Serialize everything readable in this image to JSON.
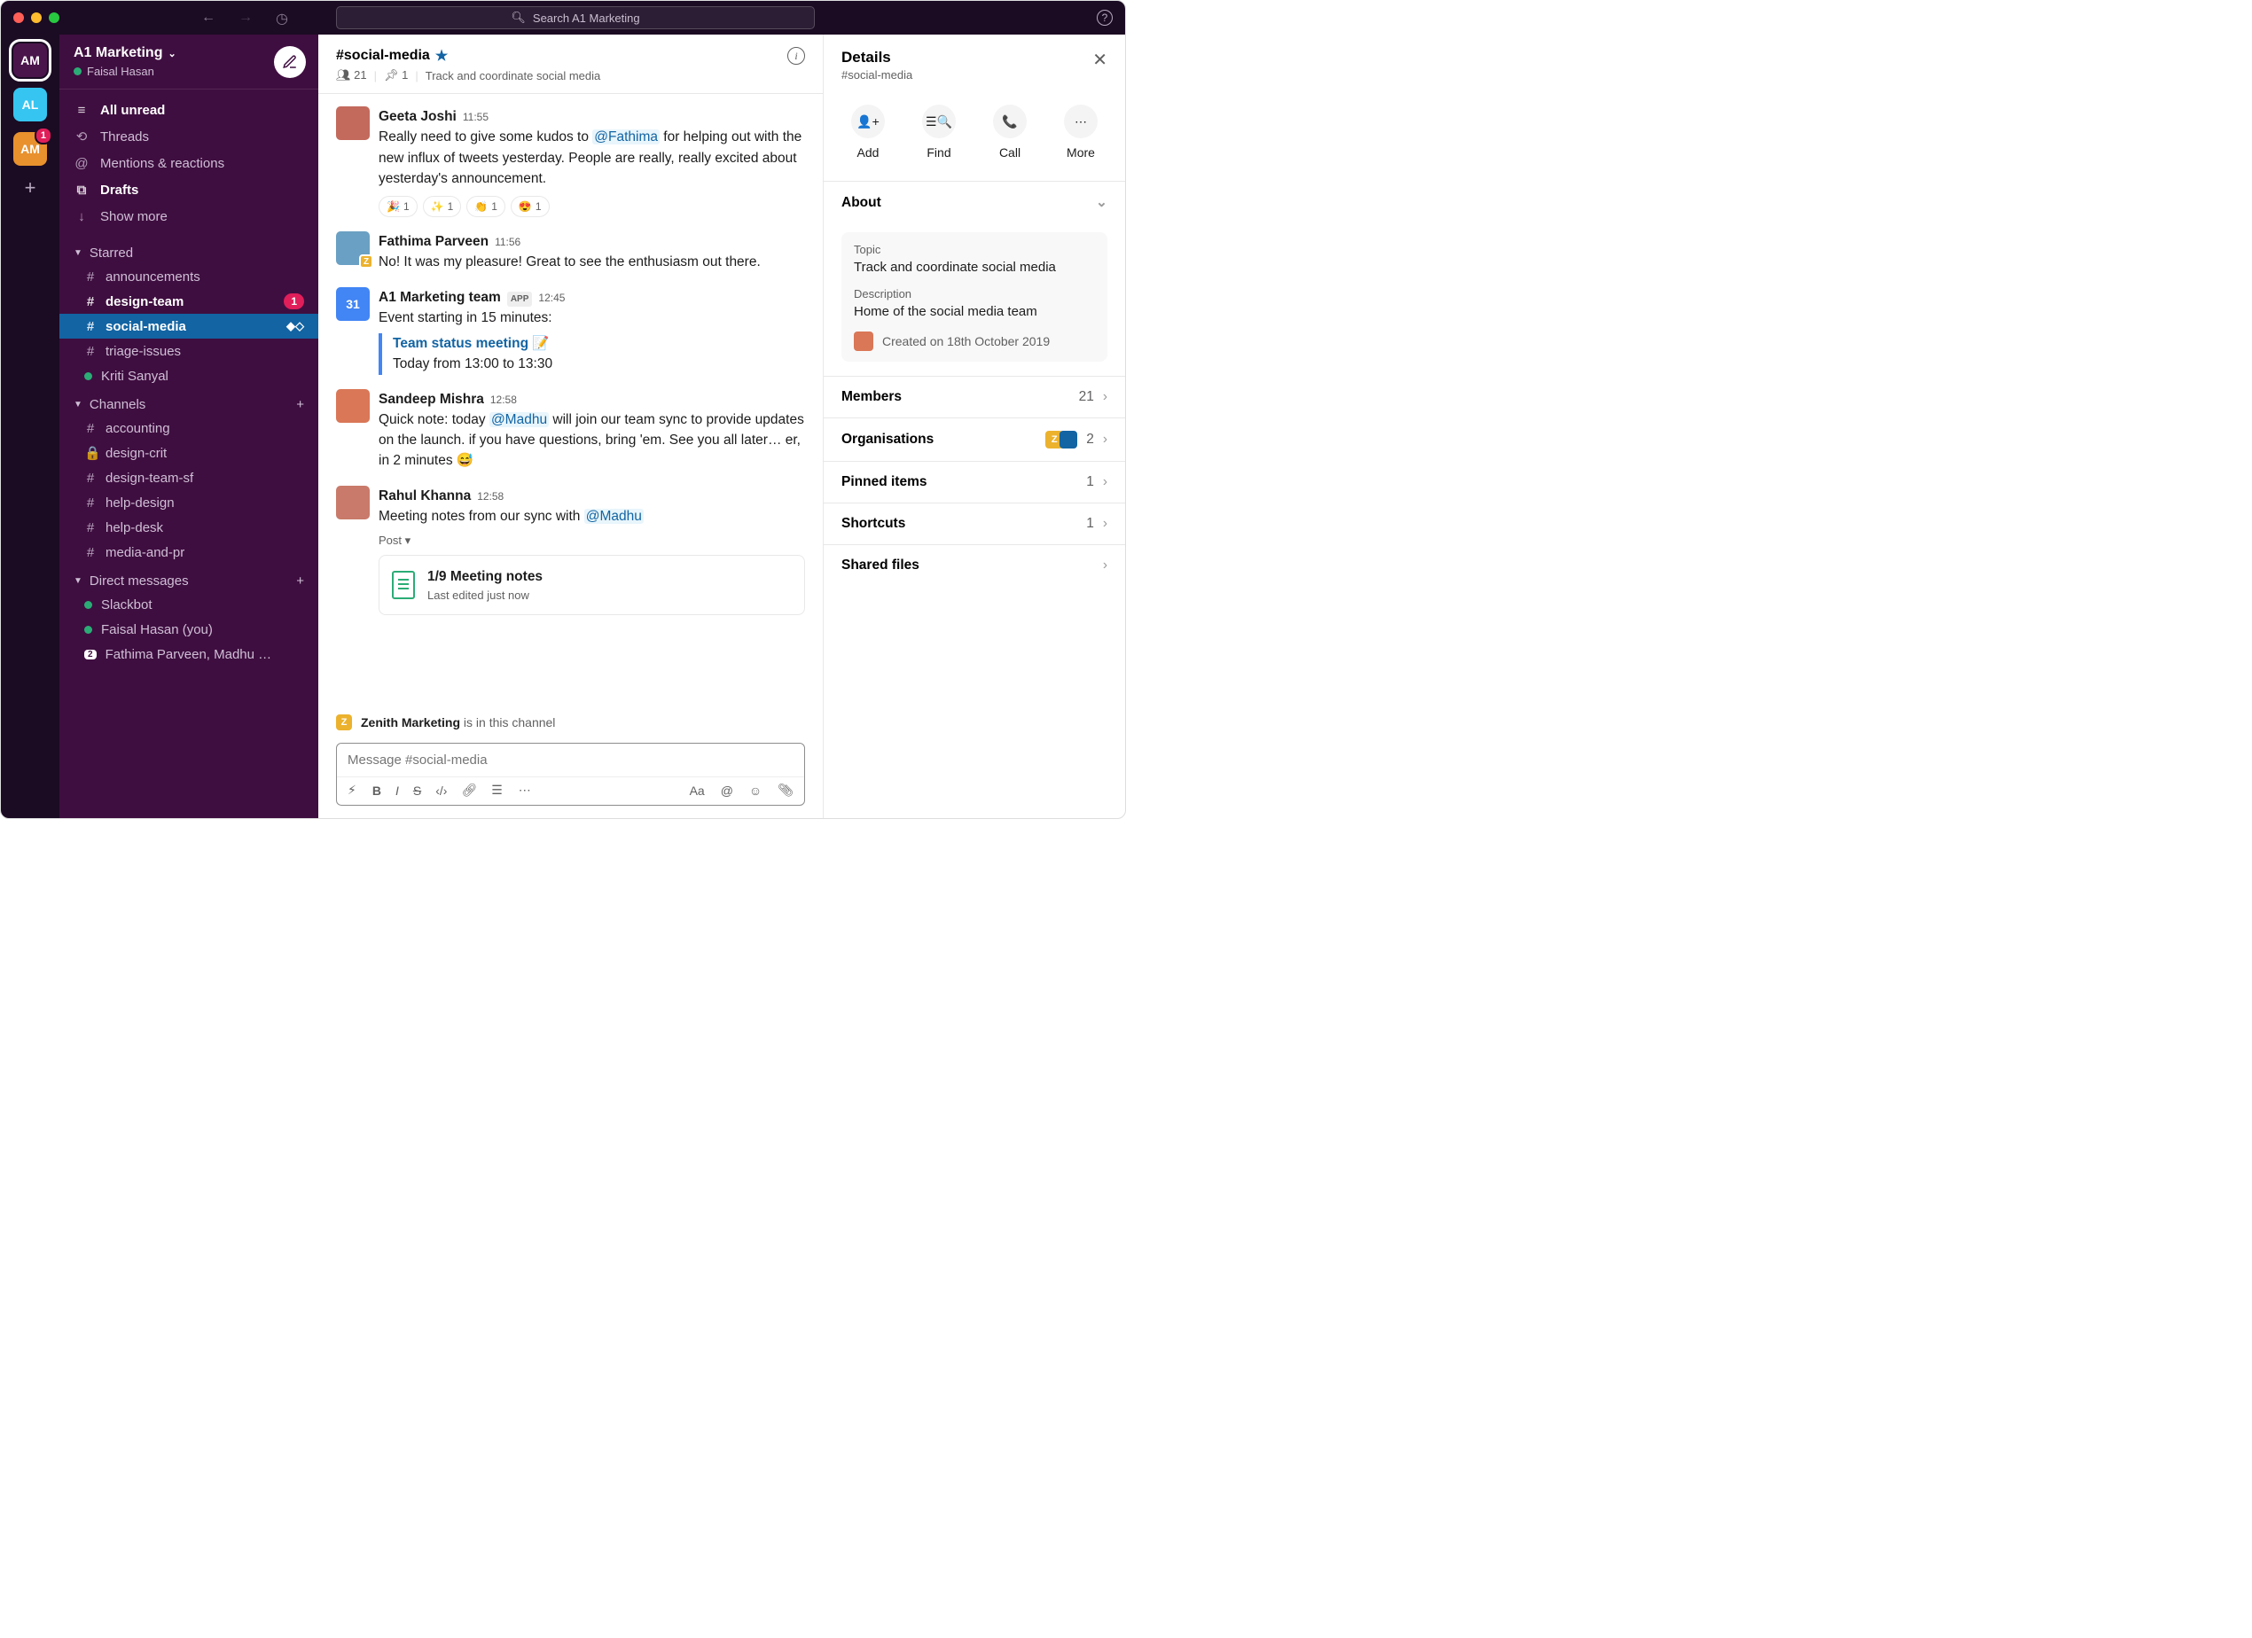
{
  "search_placeholder": "Search A1 Marketing",
  "workspaces": [
    {
      "abbr": "AM",
      "bg": "#4a154b",
      "selected": true
    },
    {
      "abbr": "AL",
      "bg": "#36c5f0"
    },
    {
      "abbr": "AM",
      "bg": "#e8912d",
      "badge": "1"
    }
  ],
  "sidebar": {
    "workspace": "A1 Marketing",
    "user": "Faisal Hasan",
    "nav": [
      {
        "icon": "≡",
        "label": "All unread",
        "bold": true
      },
      {
        "icon": "⟲",
        "label": "Threads"
      },
      {
        "icon": "@",
        "label": "Mentions & reactions"
      },
      {
        "icon": "⧉",
        "label": "Drafts",
        "bold": true
      },
      {
        "icon": "↓",
        "label": "Show more"
      }
    ],
    "starred_label": "Starred",
    "starred": [
      {
        "pre": "#",
        "label": "announcements"
      },
      {
        "pre": "#",
        "label": "design-team",
        "bold": true,
        "badge": "1"
      },
      {
        "pre": "#",
        "label": "social-media",
        "active": true,
        "shared": "◆◇"
      },
      {
        "pre": "#",
        "label": "triage-issues"
      },
      {
        "pre": "●",
        "label": "Kriti Sanyal",
        "presence": true
      }
    ],
    "channels_label": "Channels",
    "channels": [
      {
        "pre": "#",
        "label": "accounting"
      },
      {
        "pre": "🔒",
        "label": "design-crit"
      },
      {
        "pre": "#",
        "label": "design-team-sf"
      },
      {
        "pre": "#",
        "label": "help-design"
      },
      {
        "pre": "#",
        "label": "help-desk"
      },
      {
        "pre": "#",
        "label": "media-and-pr"
      }
    ],
    "dm_label": "Direct messages",
    "dms": [
      {
        "pre": "●",
        "label": "Slackbot",
        "presence": true
      },
      {
        "pre": "●",
        "label": "Faisal Hasan (you)",
        "presence": true
      },
      {
        "pre": "2",
        "label": "Fathima Parveen, Madhu …",
        "group": true
      }
    ]
  },
  "channel": {
    "name": "#social-media",
    "members": "21",
    "pins": "1",
    "topic": "Track and coordinate social media",
    "messages": [
      {
        "avatar": "#c36a5d",
        "name": "Geeta Joshi",
        "time": "11:55",
        "html": "Really need to give some kudos to <span class='mention'>@Fathima</span> for helping out with the new influx of tweets yesterday. People are really, really excited about yesterday's announcement.",
        "reacts": [
          {
            "e": "🎉",
            "c": "1"
          },
          {
            "e": "✨",
            "c": "1"
          },
          {
            "e": "👏",
            "c": "1"
          },
          {
            "e": "😍",
            "c": "1"
          }
        ]
      },
      {
        "avatar": "#6aa0c3",
        "name": "Fathima Parveen",
        "time": "11:56",
        "corner": "#ecb22e",
        "corner_txt": "Z",
        "html": "No! It was my pleasure! Great to see the enthusiasm out there."
      },
      {
        "avatar": "#4285f4",
        "avatar_txt": "31",
        "name": "A1 Marketing team",
        "app": "APP",
        "time": "12:45",
        "html": "Event starting in 15 minutes:",
        "event": {
          "title": "Team status meeting 📝",
          "sub": "Today from 13:00 to 13:30"
        }
      },
      {
        "avatar": "#d97757",
        "name": "Sandeep Mishra",
        "time": "12:58",
        "html": "Quick note: today <span class='mention'>@Madhu</span> will join our team sync to provide updates on the launch. if you have questions, bring 'em. See you all later… er, in 2 minutes 😅"
      },
      {
        "avatar": "#c97a6a",
        "name": "Rahul Khanna",
        "time": "12:58",
        "html": "Meeting notes from our sync with <span class='mention'>@Madhu</span>",
        "post_label": "Post ▾",
        "post": {
          "title": "1/9 Meeting notes",
          "sub": "Last edited just now"
        }
      }
    ],
    "notice_org": "Zenith Marketing",
    "notice_txt": " is in this channel",
    "composer_placeholder": "Message #social-media"
  },
  "details": {
    "title": "Details",
    "sub": "#social-media",
    "actions": [
      "Add",
      "Find",
      "Call",
      "More"
    ],
    "about_label": "About",
    "topic_lbl": "Topic",
    "topic": "Track and coordinate social media",
    "desc_lbl": "Description",
    "desc": "Home of the social media team",
    "created": "Created on 18th October 2019",
    "rows": [
      {
        "label": "Members",
        "val": "21"
      },
      {
        "label": "Organisations",
        "val": "2",
        "orgs": true
      },
      {
        "label": "Pinned items",
        "val": "1"
      },
      {
        "label": "Shortcuts",
        "val": "1"
      },
      {
        "label": "Shared files",
        "val": ""
      }
    ]
  }
}
